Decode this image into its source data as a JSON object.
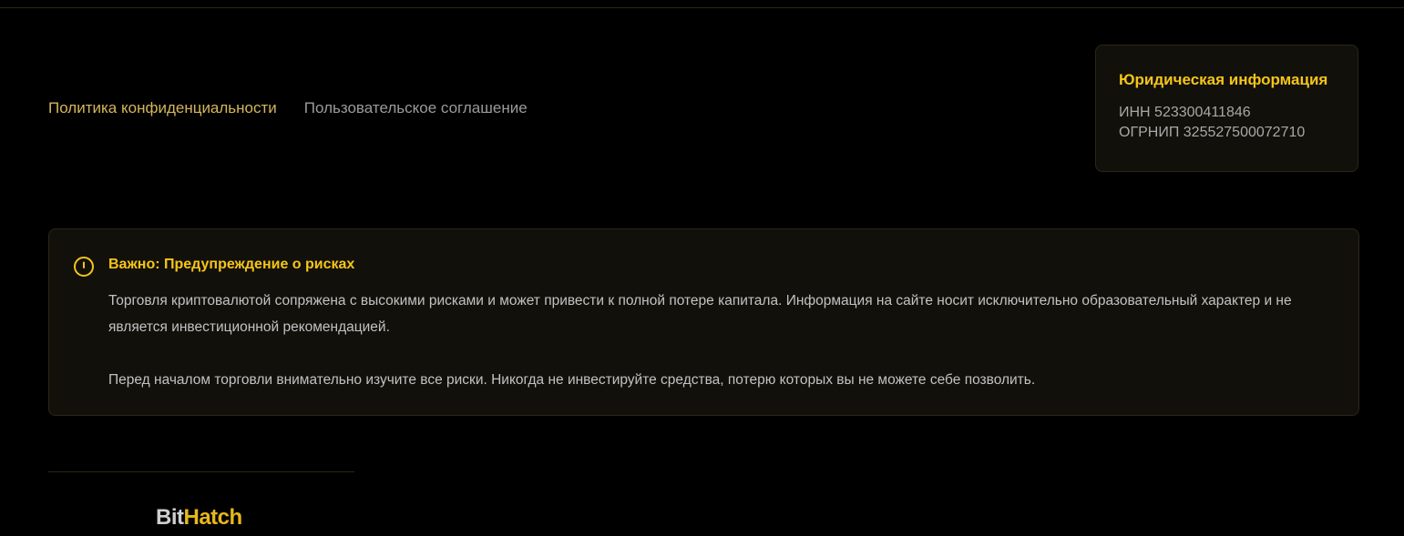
{
  "nav": {
    "privacy_label": "Политика конфиденциальности",
    "agreement_label": "Пользовательское соглашение"
  },
  "legal": {
    "title": "Юридическая информация",
    "inn": "ИНН 523300411846",
    "ogrnip": "ОГРНИП 325527500072710"
  },
  "risk": {
    "icon": "alert-circle-icon",
    "title": "Важно: Предупреждение о рисках",
    "paragraph1": "Торговля криптовалютой сопряжена с высокими рисками и может привести к полной потере капитала. Информация на сайте носит исключительно образовательный характер и не является инвестиционной рекомендацией.",
    "paragraph2": "Перед началом торговли внимательно изучите все риски. Никогда не инвестируйте средства, потерю которых вы не можете себе позволить."
  },
  "logo": {
    "part1": "Bit",
    "part2": "Hatch"
  },
  "colors": {
    "accent": "#f5c518",
    "background": "#000000",
    "card": "#12100a"
  }
}
